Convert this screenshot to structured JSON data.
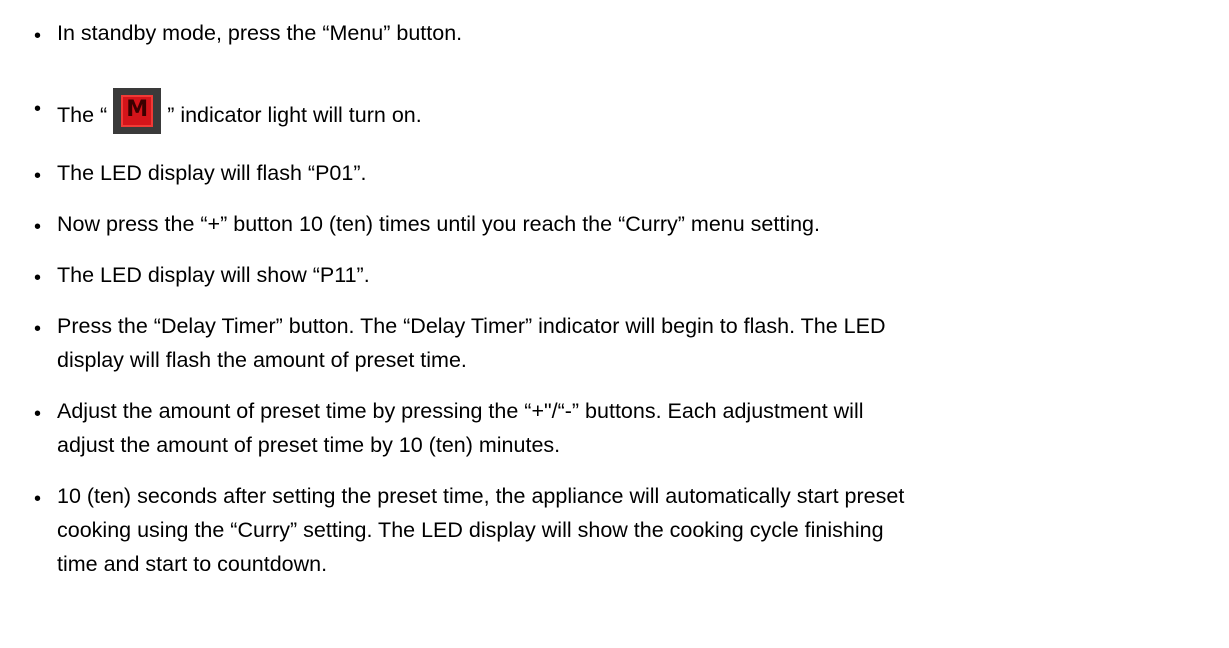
{
  "steps": [
    {
      "text": "In standby mode, press the “Menu” button."
    },
    {
      "before": "The “",
      "indicator_glyph": "M",
      "indicator_icon": "menu-indicator-light-icon",
      "after": "” indicator light will turn on."
    },
    {
      "text": "The LED display will flash “P01”."
    },
    {
      "text": "Now press the “+” button 10 (ten) times until you reach the “Curry” menu setting."
    },
    {
      "text": "The LED display will show “P11”."
    },
    {
      "lines": [
        "Press the “Delay Timer” button.  The “Delay Timer” indicator will begin to flash.  The LED",
        "display will flash the amount of preset time."
      ]
    },
    {
      "lines": [
        "Adjust the amount of preset time by pressing the “+\"/“-” buttons.  Each adjustment will",
        "adjust the amount of preset time by 10 (ten) minutes."
      ]
    },
    {
      "lines": [
        "10 (ten) seconds after setting the preset time, the appliance will automatically start preset",
        "cooking using the “Curry” setting.  The LED display will show the cooking cycle finishing",
        "time and start to countdown."
      ]
    }
  ],
  "bullet_symbol": "•",
  "colors": {
    "text": "#000000",
    "indicator_bg": "#3a3a3a",
    "indicator_led": "#d4141a"
  }
}
